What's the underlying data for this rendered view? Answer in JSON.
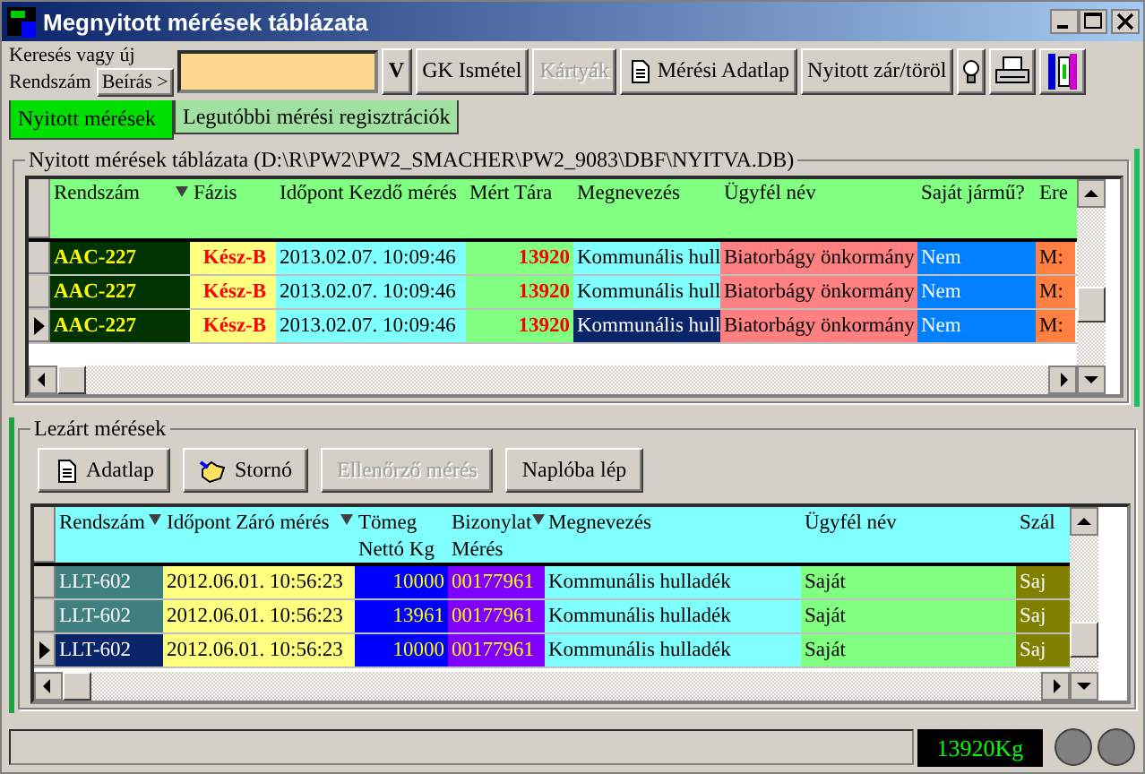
{
  "window": {
    "title": "Megnyitott mérések táblázata"
  },
  "toolbar": {
    "search_label": [
      "Keresés vagy új",
      "Rendszám"
    ],
    "enter_button": "Beírás >",
    "buttons": [
      {
        "label": "V",
        "disabled": false
      },
      {
        "label": "GK Ismétel",
        "disabled": false
      },
      {
        "label": "Kártyák",
        "disabled": true
      },
      {
        "label": "Mérési Adatlap",
        "disabled": false,
        "kind": "doc"
      },
      {
        "label": "Nyitott zár/töröl",
        "disabled": false
      }
    ]
  },
  "tabs": [
    {
      "label": "Nyitott mérések",
      "selected": true
    },
    {
      "label": "Legutóbbi mérési regisztrációk",
      "selected": false
    }
  ],
  "open_table": {
    "title": "Nyitott mérések táblázata (D:\\R\\PW2\\PW2_SMACHER\\PW2_9083\\DBF\\NYITVA.DB)",
    "columns": [
      {
        "label": "Rendszám",
        "sort_marker": true,
        "focused": false,
        "color": "#003300"
      },
      {
        "label": "Fázis",
        "sort_marker": false,
        "focused": false,
        "color": "#ffff80"
      },
      {
        "label": "Időpont Kezdő mérés",
        "sort_marker": false,
        "focused": false,
        "color": "#80ffff"
      },
      {
        "label": "Mért Tára",
        "sort_marker": false,
        "focused": false,
        "color": "#80ff80"
      },
      {
        "label": "Megnevezés",
        "sort_marker": false,
        "focused": true,
        "color": "#80ffff"
      },
      {
        "label": "Ügyfél név",
        "sort_marker": false,
        "focused": false,
        "color": "#ff8080"
      },
      {
        "label": "Saját jármű?",
        "sort_marker": false,
        "focused": false,
        "color": "#0080ff"
      },
      {
        "label": "Ere",
        "sort_marker": false,
        "focused": false,
        "color": "#ff8040"
      }
    ],
    "rows": [
      {
        "current": false,
        "cells": [
          "AAC-227",
          "Kész-B",
          "2013.02.07. 10:09:46",
          "13920",
          "Kommunális hull",
          "Biatorbágy önkormány",
          "Nem",
          "M:"
        ]
      },
      {
        "current": false,
        "cells": [
          "AAC-227",
          "Kész-B",
          "2013.02.07. 10:09:46",
          "13920",
          "Kommunális hull",
          "Biatorbágy önkormány",
          "Nem",
          "M:"
        ]
      },
      {
        "current": true,
        "cells": [
          "AAC-227",
          "Kész-B",
          "2013.02.07. 10:09:46",
          "13920",
          "Kommunális hull",
          "Biatorbágy önkormány",
          "Nem",
          "M:"
        ]
      }
    ]
  },
  "closed_section": {
    "title": "Lezárt mérések",
    "buttons": [
      {
        "label": "Adatlap",
        "disabled": false,
        "kind": "doc"
      },
      {
        "label": "Stornó",
        "disabled": false,
        "kind": "hand"
      },
      {
        "label": "Ellenőrző mérés",
        "disabled": true
      },
      {
        "label": "Naplóba lép",
        "disabled": false
      }
    ],
    "columns": [
      {
        "label": "Rendszám",
        "sort_marker": true,
        "focused": true,
        "color": "#408080"
      },
      {
        "label": "Időpont Záró mérés",
        "sort_marker": true,
        "focused": false,
        "color": "#ffff80"
      },
      {
        "label": "Tömeg Nettó Kg",
        "sort_marker": false,
        "focused": false,
        "color": "#0000ff"
      },
      {
        "label": "Bizonylat Mérés",
        "sort_marker": true,
        "focused": false,
        "color": "#8000ff"
      },
      {
        "label": "Megnevezés",
        "sort_marker": false,
        "focused": false,
        "color": "#80ffff"
      },
      {
        "label": "Ügyfél név",
        "sort_marker": false,
        "focused": false,
        "color": "#80ff80"
      },
      {
        "label": "Szál",
        "sort_marker": false,
        "focused": false,
        "color": "#808000"
      }
    ],
    "rows": [
      {
        "current": false,
        "cells": [
          "LLT-602",
          "2012.06.01. 10:56:23",
          "10000",
          "00177961",
          "Kommunális hulladék",
          "Saját",
          "Saj"
        ]
      },
      {
        "current": false,
        "cells": [
          "LLT-602",
          "2012.06.01. 10:56:23",
          "13961",
          "00177961",
          "Kommunális hulladék",
          "Saját",
          "Saj"
        ]
      },
      {
        "current": true,
        "cells": [
          "LLT-602",
          "2012.06.01. 10:56:23",
          "10000",
          "00177961",
          "Kommunális hulladék",
          "Saját",
          "Saj"
        ]
      }
    ]
  },
  "status_bar": {
    "weight": "13920Kg"
  }
}
